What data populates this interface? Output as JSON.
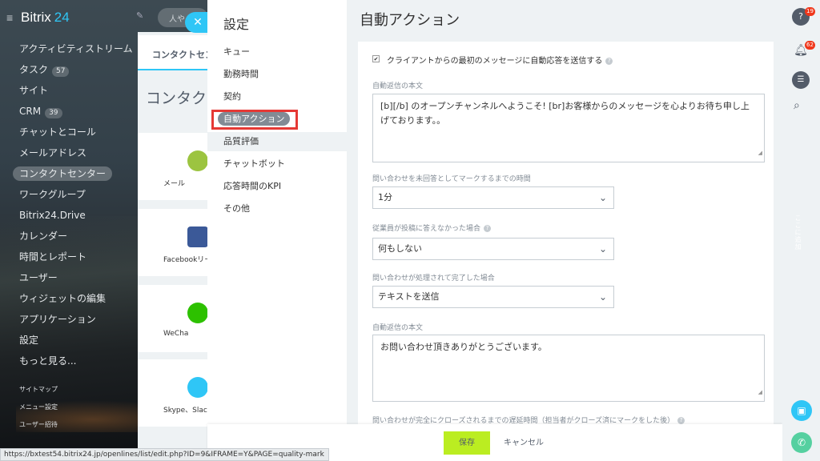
{
  "app": {
    "logo_text": "Bitrix",
    "logo_num": "24"
  },
  "search": {
    "placeholder": "人や"
  },
  "sidebar": {
    "items": [
      {
        "label": "アクティビティストリーム"
      },
      {
        "label": "タスク",
        "count": "57"
      },
      {
        "label": "サイト"
      },
      {
        "label": "CRM",
        "count": "39"
      },
      {
        "label": "チャットとコール"
      },
      {
        "label": "メールアドレス"
      },
      {
        "label": "コンタクトセンター",
        "active": true
      },
      {
        "label": "ワークグループ"
      },
      {
        "label": "Bitrix24.Drive"
      },
      {
        "label": "カレンダー"
      },
      {
        "label": "時間とレポート"
      },
      {
        "label": "ユーザー"
      },
      {
        "label": "ウィジェットの編集"
      },
      {
        "label": "アプリケーション"
      },
      {
        "label": "設定"
      },
      {
        "label": "もっと見る..."
      }
    ],
    "small_items": [
      {
        "label": "サイトマップ"
      },
      {
        "label": "メニュー設定"
      },
      {
        "label": "ユーザー招待"
      }
    ]
  },
  "background": {
    "tab_label": "コンタクトセン",
    "title": "コンタク",
    "cards": [
      {
        "label": "メール",
        "color": "#9cc440"
      },
      {
        "label": "Facebookリー",
        "color": "#3b5998"
      },
      {
        "label": "WeCha",
        "color": "#2dc100"
      },
      {
        "label": "Skype、Slack",
        "color": "#2fc6f6"
      }
    ]
  },
  "settings": {
    "title": "設定",
    "nav": [
      {
        "label": "キュー"
      },
      {
        "label": "勤務時間"
      },
      {
        "label": "契約"
      },
      {
        "label": "自動アクション",
        "selected": true
      },
      {
        "label": "品質評価",
        "current": true
      },
      {
        "label": "チャットボット"
      },
      {
        "label": "応答時間のKPI"
      },
      {
        "label": "その他"
      }
    ]
  },
  "content": {
    "title": "自動アクション",
    "checkbox_label": "クライアントからの最初のメッセージに自動応答を送信する",
    "auto_reply_label": "自動返信の本文",
    "auto_reply_text": "[b][/b] のオープンチャンネルへようこそ! [br]お客様からのメッセージを心よりお待ち申し上げております。。",
    "unanswered_label": "問い合わせを未回答としてマークするまでの時間",
    "unanswered_value": "1分",
    "no_answer_label": "従業員が投稿に答えなかった場合",
    "no_answer_value": "何もしない",
    "completed_label": "問い合わせが処理されて完了した場合",
    "completed_value": "テキストを送信",
    "auto_reply2_label": "自動返信の本文",
    "auto_reply2_text": "お問い合わせ頂きありがとうございます。",
    "delay_label": "問い合わせが完全にクローズされるまでの遅延時間（担当者がクローズ済にマークをした後）"
  },
  "footer": {
    "save_label": "保存",
    "cancel_label": "キャンセル"
  },
  "rail": {
    "help_badge": "19",
    "notify_badge": "62",
    "vertical_text": "ここに追加"
  },
  "status_bar": {
    "url": "https://bxtest54.bitrix24.jp/openlines/list/edit.php?ID=9&IFRAME=Y&PAGE=quality-mark"
  },
  "colors": {
    "accent": "#2fc6f6",
    "save": "#bbed21",
    "highlight": "#e53935",
    "badge": "#f0371b"
  }
}
